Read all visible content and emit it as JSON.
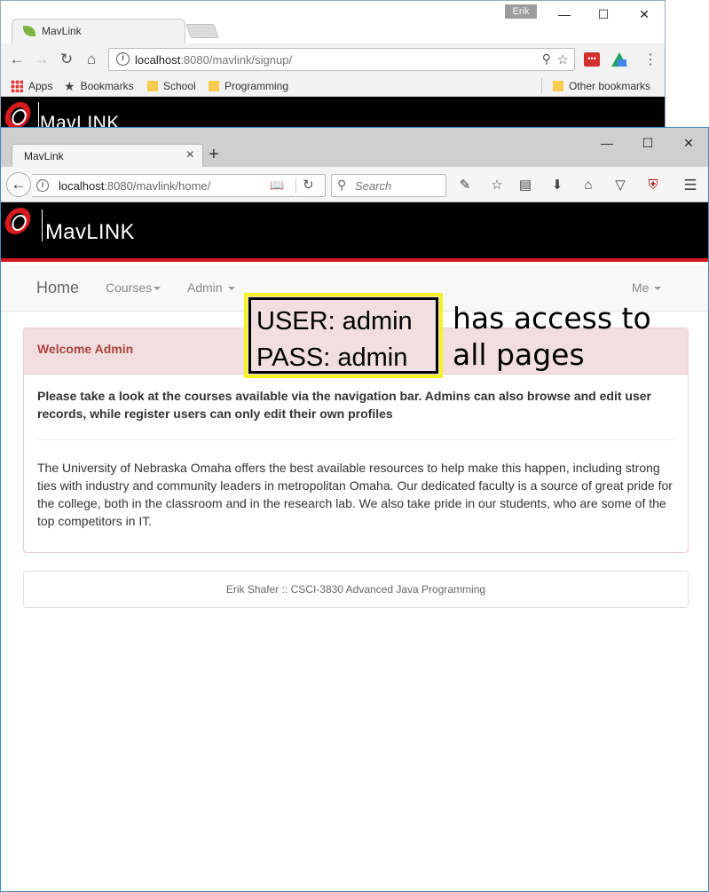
{
  "chrome_window": {
    "tab_title": "MavLink",
    "profile_name": "Erik",
    "url_host": "localhost",
    "url_rest": ":8080/mavlink/signup/",
    "bookmarks": [
      "Apps",
      "Bookmarks",
      "School",
      "Programming"
    ],
    "other_bookmarks": "Other bookmarks",
    "brand": "MavLINK"
  },
  "firefox_window": {
    "tab_title": "MavLink",
    "url_host": "localhost",
    "url_rest": ":8080/mavlink/home/",
    "search_placeholder": "Search"
  },
  "site": {
    "brand": "MavLINK",
    "nav": {
      "home": "Home",
      "courses": "Courses",
      "admin": "Admin",
      "me": "Me"
    },
    "panel": {
      "heading": "Welcome Admin",
      "lead": "Please take a look at the courses available via the navigation bar. Admins can also browse and edit user records, while register users can only edit their own profiles",
      "body": "The University of Nebraska Omaha offers the best available resources to help make this happen, including strong ties with industry and community leaders in metropolitan Omaha. Our dedicated faculty is a source of great pride for the college, both in the classroom and in the research lab. We also take pride in our students, who are some of the top competitors in IT."
    },
    "footer": "Erik Shafer :: CSCI-3830 Advanced Java Programming"
  },
  "annotation": {
    "user_line": "USER: admin",
    "pass_line": "PASS: admin",
    "note_line1": "has access to",
    "note_line2": "all pages"
  },
  "colors": {
    "brand_red": "#d71920",
    "panel_danger_bg": "#f2dede",
    "panel_danger_text": "#a94442",
    "annotation_border": "#f5f224"
  }
}
